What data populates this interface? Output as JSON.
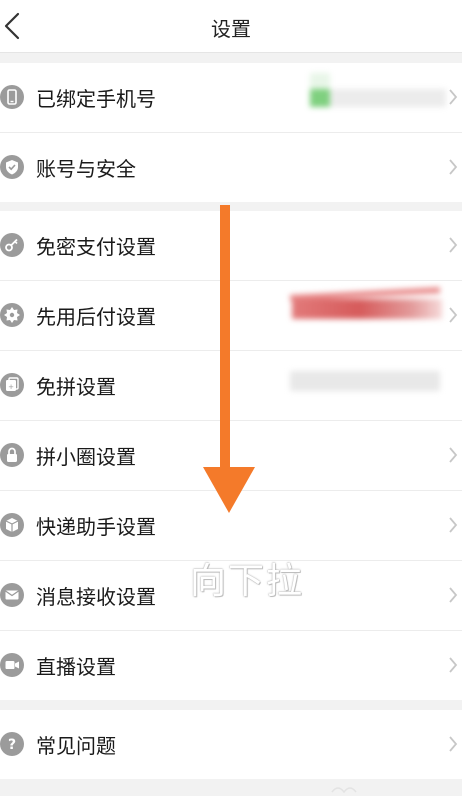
{
  "header": {
    "title": "设置"
  },
  "groups": [
    {
      "items": [
        {
          "label": "已绑定手机号",
          "icon": "phone-icon"
        },
        {
          "label": "账号与安全",
          "icon": "shield-icon"
        }
      ]
    },
    {
      "items": [
        {
          "label": "免密支付设置",
          "icon": "key-icon"
        },
        {
          "label": "先用后付设置",
          "icon": "badge-icon"
        },
        {
          "label": "免拼设置",
          "icon": "card-icon"
        },
        {
          "label": "拼小圈设置",
          "icon": "lock-icon"
        },
        {
          "label": "快递助手设置",
          "icon": "package-icon"
        },
        {
          "label": "消息接收设置",
          "icon": "mail-icon"
        },
        {
          "label": "直播设置",
          "icon": "video-icon"
        }
      ]
    },
    {
      "items": [
        {
          "label": "常见问题",
          "icon": "question-icon"
        }
      ]
    }
  ],
  "annotation": {
    "text": "向下拉",
    "arrow_color": "#f47a2a"
  },
  "colors": {
    "icon": "#9b9b9b",
    "chevron": "#c7c7c7",
    "background": "#f2f2f2"
  }
}
